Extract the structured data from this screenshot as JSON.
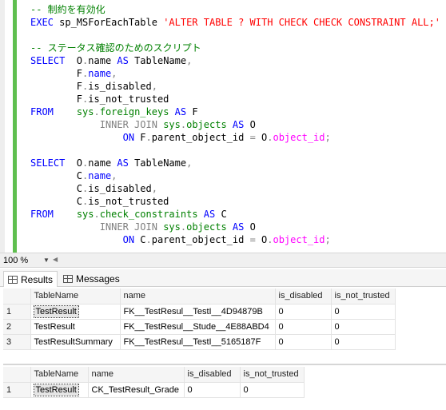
{
  "editor": {
    "lines": [
      [
        {
          "t": "-- 制約を有効化",
          "c": "cm"
        }
      ],
      [
        {
          "t": "EXEC",
          "c": "kw"
        },
        {
          "t": " sp_MSForEachTable ",
          "c": ""
        },
        {
          "t": "'ALTER TABLE ? WITH CHECK CHECK CONSTRAINT ALL;'",
          "c": "str"
        }
      ],
      [],
      [
        {
          "t": "-- ステータス確認のためのスクリプト",
          "c": "cm"
        }
      ],
      [
        {
          "t": "SELECT",
          "c": "kw"
        },
        {
          "t": "  O",
          "c": ""
        },
        {
          "t": ".",
          "c": "gray"
        },
        {
          "t": "name ",
          "c": ""
        },
        {
          "t": "AS",
          "c": "kw"
        },
        {
          "t": " TableName",
          "c": ""
        },
        {
          "t": ",",
          "c": "gray"
        }
      ],
      [
        {
          "t": "        F",
          "c": ""
        },
        {
          "t": ".",
          "c": "gray"
        },
        {
          "t": "name",
          "c": "kw"
        },
        {
          "t": ",",
          "c": "gray"
        }
      ],
      [
        {
          "t": "        F",
          "c": ""
        },
        {
          "t": ".",
          "c": "gray"
        },
        {
          "t": "is_disabled",
          "c": ""
        },
        {
          "t": ",",
          "c": "gray"
        }
      ],
      [
        {
          "t": "        F",
          "c": ""
        },
        {
          "t": ".",
          "c": "gray"
        },
        {
          "t": "is_not_trusted",
          "c": ""
        }
      ],
      [
        {
          "t": "FROM",
          "c": "kw"
        },
        {
          "t": "    ",
          "c": ""
        },
        {
          "t": "sys",
          "c": "sys"
        },
        {
          "t": ".",
          "c": "gray"
        },
        {
          "t": "foreign_keys",
          "c": "sys"
        },
        {
          "t": " ",
          "c": ""
        },
        {
          "t": "AS",
          "c": "kw"
        },
        {
          "t": " F",
          "c": ""
        }
      ],
      [
        {
          "t": "            ",
          "c": ""
        },
        {
          "t": "INNER JOIN",
          "c": "gray"
        },
        {
          "t": " ",
          "c": ""
        },
        {
          "t": "sys",
          "c": "sys"
        },
        {
          "t": ".",
          "c": "gray"
        },
        {
          "t": "objects",
          "c": "sys"
        },
        {
          "t": " ",
          "c": ""
        },
        {
          "t": "AS",
          "c": "kw"
        },
        {
          "t": " O",
          "c": ""
        }
      ],
      [
        {
          "t": "                ",
          "c": ""
        },
        {
          "t": "ON",
          "c": "kw"
        },
        {
          "t": " F",
          "c": ""
        },
        {
          "t": ".",
          "c": "gray"
        },
        {
          "t": "parent_object_id ",
          "c": ""
        },
        {
          "t": "=",
          "c": "gray"
        },
        {
          "t": " O",
          "c": ""
        },
        {
          "t": ".",
          "c": "gray"
        },
        {
          "t": "object_id",
          "c": "fn"
        },
        {
          "t": ";",
          "c": "gray"
        }
      ],
      [],
      [
        {
          "t": "SELECT",
          "c": "kw"
        },
        {
          "t": "  O",
          "c": ""
        },
        {
          "t": ".",
          "c": "gray"
        },
        {
          "t": "name ",
          "c": ""
        },
        {
          "t": "AS",
          "c": "kw"
        },
        {
          "t": " TableName",
          "c": ""
        },
        {
          "t": ",",
          "c": "gray"
        }
      ],
      [
        {
          "t": "        C",
          "c": ""
        },
        {
          "t": ".",
          "c": "gray"
        },
        {
          "t": "name",
          "c": "kw"
        },
        {
          "t": ",",
          "c": "gray"
        }
      ],
      [
        {
          "t": "        C",
          "c": ""
        },
        {
          "t": ".",
          "c": "gray"
        },
        {
          "t": "is_disabled",
          "c": ""
        },
        {
          "t": ",",
          "c": "gray"
        }
      ],
      [
        {
          "t": "        C",
          "c": ""
        },
        {
          "t": ".",
          "c": "gray"
        },
        {
          "t": "is_not_trusted",
          "c": ""
        }
      ],
      [
        {
          "t": "FROM",
          "c": "kw"
        },
        {
          "t": "    ",
          "c": ""
        },
        {
          "t": "sys",
          "c": "sys"
        },
        {
          "t": ".",
          "c": "gray"
        },
        {
          "t": "check_constraints",
          "c": "sys"
        },
        {
          "t": " ",
          "c": ""
        },
        {
          "t": "AS",
          "c": "kw"
        },
        {
          "t": " C",
          "c": ""
        }
      ],
      [
        {
          "t": "            ",
          "c": ""
        },
        {
          "t": "INNER JOIN",
          "c": "gray"
        },
        {
          "t": " ",
          "c": ""
        },
        {
          "t": "sys",
          "c": "sys"
        },
        {
          "t": ".",
          "c": "gray"
        },
        {
          "t": "objects",
          "c": "sys"
        },
        {
          "t": " ",
          "c": ""
        },
        {
          "t": "AS",
          "c": "kw"
        },
        {
          "t": " O",
          "c": ""
        }
      ],
      [
        {
          "t": "                ",
          "c": ""
        },
        {
          "t": "ON",
          "c": "kw"
        },
        {
          "t": " C",
          "c": ""
        },
        {
          "t": ".",
          "c": "gray"
        },
        {
          "t": "parent_object_id ",
          "c": ""
        },
        {
          "t": "=",
          "c": "gray"
        },
        {
          "t": " O",
          "c": ""
        },
        {
          "t": ".",
          "c": "gray"
        },
        {
          "t": "object_id",
          "c": "fn"
        },
        {
          "t": ";",
          "c": "gray"
        }
      ]
    ]
  },
  "zoom": {
    "value": "100 %"
  },
  "tabs": {
    "results_label": "Results",
    "messages_label": "Messages"
  },
  "grid1": {
    "columns": [
      "TableName",
      "name",
      "is_disabled",
      "is_not_trusted"
    ],
    "rows": [
      {
        "num": "1",
        "cells": [
          "TestResult",
          "FK__TestResul__TestI__4D94879B",
          "0",
          "0"
        ]
      },
      {
        "num": "2",
        "cells": [
          "TestResult",
          "FK__TestResul__Stude__4E88ABD4",
          "0",
          "0"
        ]
      },
      {
        "num": "3",
        "cells": [
          "TestResultSummary",
          "FK__TestResul__TestI__5165187F",
          "0",
          "0"
        ]
      }
    ]
  },
  "grid2": {
    "columns": [
      "TableName",
      "name",
      "is_disabled",
      "is_not_trusted"
    ],
    "rows": [
      {
        "num": "1",
        "cells": [
          "TestResult",
          "CK_TestResult_Grade",
          "0",
          "0"
        ]
      }
    ]
  },
  "colors": {
    "keyword": "#0000ff",
    "comment": "#008000",
    "string": "#ff0000",
    "function": "#ff00ff",
    "change_bar": "#5fbf4f"
  }
}
